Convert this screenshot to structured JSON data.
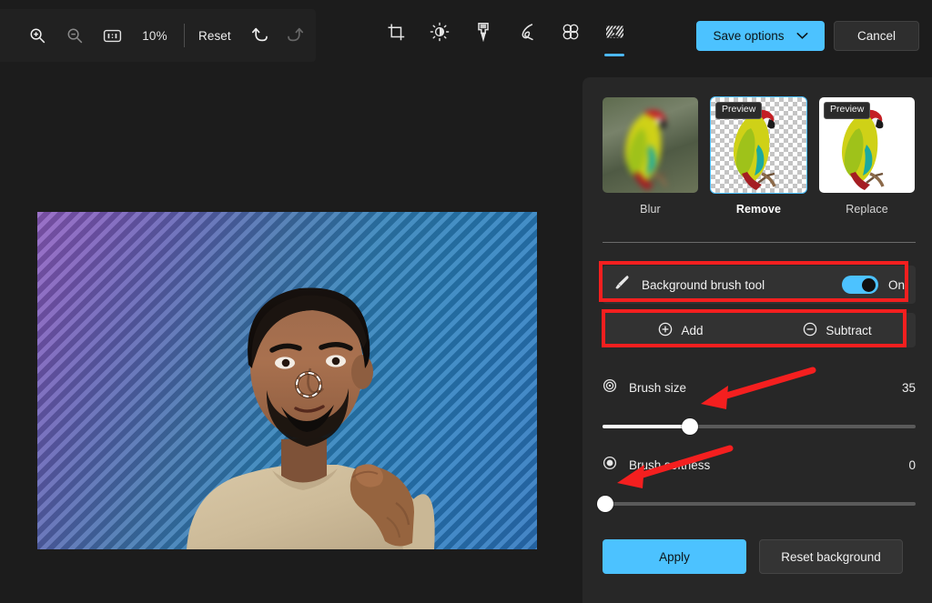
{
  "toolbar": {
    "zoom_in_icon": "zoom-in-icon",
    "zoom_out_icon": "zoom-out-icon",
    "actual_size_icon": "one-to-one-icon",
    "zoom_level": "10%",
    "reset_label": "Reset",
    "undo_icon": "undo-icon",
    "redo_icon": "redo-icon",
    "tools": [
      {
        "name": "crop",
        "icon": "crop-icon",
        "selected": false
      },
      {
        "name": "adjustment",
        "icon": "brightness-icon",
        "selected": false
      },
      {
        "name": "markup-highlighter",
        "icon": "highlighter-icon",
        "selected": false
      },
      {
        "name": "markup-pen",
        "icon": "pen-icon",
        "selected": false
      },
      {
        "name": "erase",
        "icon": "erase-icon",
        "selected": false
      },
      {
        "name": "background",
        "icon": "background-icon",
        "selected": true
      }
    ],
    "save_label": "Save options",
    "save_chevron_icon": "chevron-down-icon",
    "cancel_label": "Cancel"
  },
  "canvas": {
    "brush_cursor_icon": "brush-cursor-circle",
    "image_description": "person pointing in front of striped purple-blue background"
  },
  "panel": {
    "thumbnails": [
      {
        "label": "Blur",
        "badge": "",
        "selected": false,
        "style": "blur"
      },
      {
        "label": "Remove",
        "badge": "Preview",
        "selected": true,
        "style": "transparent"
      },
      {
        "label": "Replace",
        "badge": "Preview",
        "selected": false,
        "style": "white"
      }
    ],
    "brush_tool": {
      "icon": "paintbrush-icon",
      "label": "Background brush tool",
      "toggle_state": "On",
      "toggle_on": true
    },
    "modes": [
      {
        "label": "Add",
        "icon": "plus-circle-icon"
      },
      {
        "label": "Subtract",
        "icon": "minus-circle-icon"
      }
    ],
    "sliders": [
      {
        "name": "brush-size",
        "icon": "target-icon",
        "label": "Brush size",
        "value": "35",
        "percent": 28
      },
      {
        "name": "brush-softness",
        "icon": "dot-circle-icon",
        "label": "Brush softness",
        "value": "0",
        "percent": 0
      }
    ],
    "apply_label": "Apply",
    "reset_background_label": "Reset background"
  },
  "annotations": {
    "accent_color": "#f41f1f",
    "boxes": [
      {
        "name": "highlight-brush-tool-row"
      },
      {
        "name": "highlight-add-subtract-row"
      }
    ],
    "arrows": [
      {
        "name": "arrow-to-brush-size-slider"
      },
      {
        "name": "arrow-to-brush-softness-slider"
      }
    ]
  },
  "colors": {
    "accent_blue": "#4cc2ff",
    "app_background": "#1c1c1c",
    "panel_background": "#272727",
    "annotation_red": "#f41f1f"
  }
}
